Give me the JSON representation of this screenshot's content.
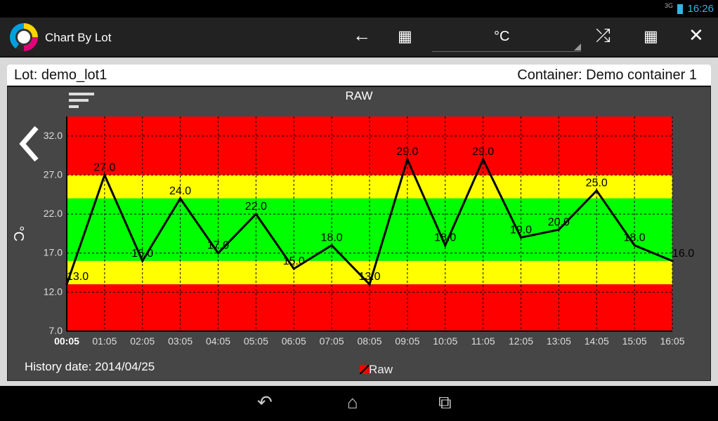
{
  "status_bar": {
    "signal": "3G",
    "time": "16:26"
  },
  "action_bar": {
    "title": "Chart By Lot",
    "unit_select": "°C",
    "icons": [
      "arrow-left-icon",
      "calendar-icon",
      "shuffle-icon",
      "grid-icon",
      "close-icon"
    ]
  },
  "header": {
    "lot": "Lot: demo_lot1",
    "container": "Container: Demo container 1"
  },
  "footer": {
    "history_date": "History date: 2014/04/25"
  },
  "colors": {
    "red": "#ff0000",
    "yellow": "#ffff00",
    "green": "#00ff00",
    "line": "#000000"
  },
  "chart_data": {
    "type": "line",
    "title": "RAW",
    "ylabel": "°C",
    "xlabel": "",
    "categories": [
      "00:05",
      "01:05",
      "02:05",
      "03:05",
      "04:05",
      "05:05",
      "06:05",
      "07:05",
      "08:05",
      "09:05",
      "10:05",
      "11:05",
      "12:05",
      "13:05",
      "14:05",
      "15:05",
      "16:05"
    ],
    "series": [
      {
        "name": "Raw",
        "values": [
          13,
          27,
          16,
          24,
          17,
          22,
          15,
          18,
          13,
          29,
          18,
          29,
          19,
          20,
          25,
          18,
          16
        ]
      }
    ],
    "data_labels": [
      "13.0",
      "27.0",
      "16.0",
      "24.0",
      "17.0",
      "22.0",
      "15.0",
      "18.0",
      "13.0",
      "29.0",
      "18.0",
      "29.0",
      "19.0",
      "20.0",
      "25.0",
      "18.0",
      "16.0"
    ],
    "yticks": [
      7,
      12,
      17,
      22,
      27,
      32
    ],
    "ytick_labels": [
      "7.0",
      "12.0",
      "17.0",
      "22.0",
      "27.0",
      "32.0"
    ],
    "ylim": [
      7,
      34.5
    ],
    "bands": [
      {
        "from": 27,
        "to": 34.5,
        "color": "#ff0000"
      },
      {
        "from": 24,
        "to": 27,
        "color": "#ffff00"
      },
      {
        "from": 16,
        "to": 24,
        "color": "#00ff00"
      },
      {
        "from": 13,
        "to": 16,
        "color": "#ffff00"
      },
      {
        "from": 7,
        "to": 13,
        "color": "#ff0000"
      }
    ],
    "grid": true,
    "legend": "bottom-center"
  }
}
